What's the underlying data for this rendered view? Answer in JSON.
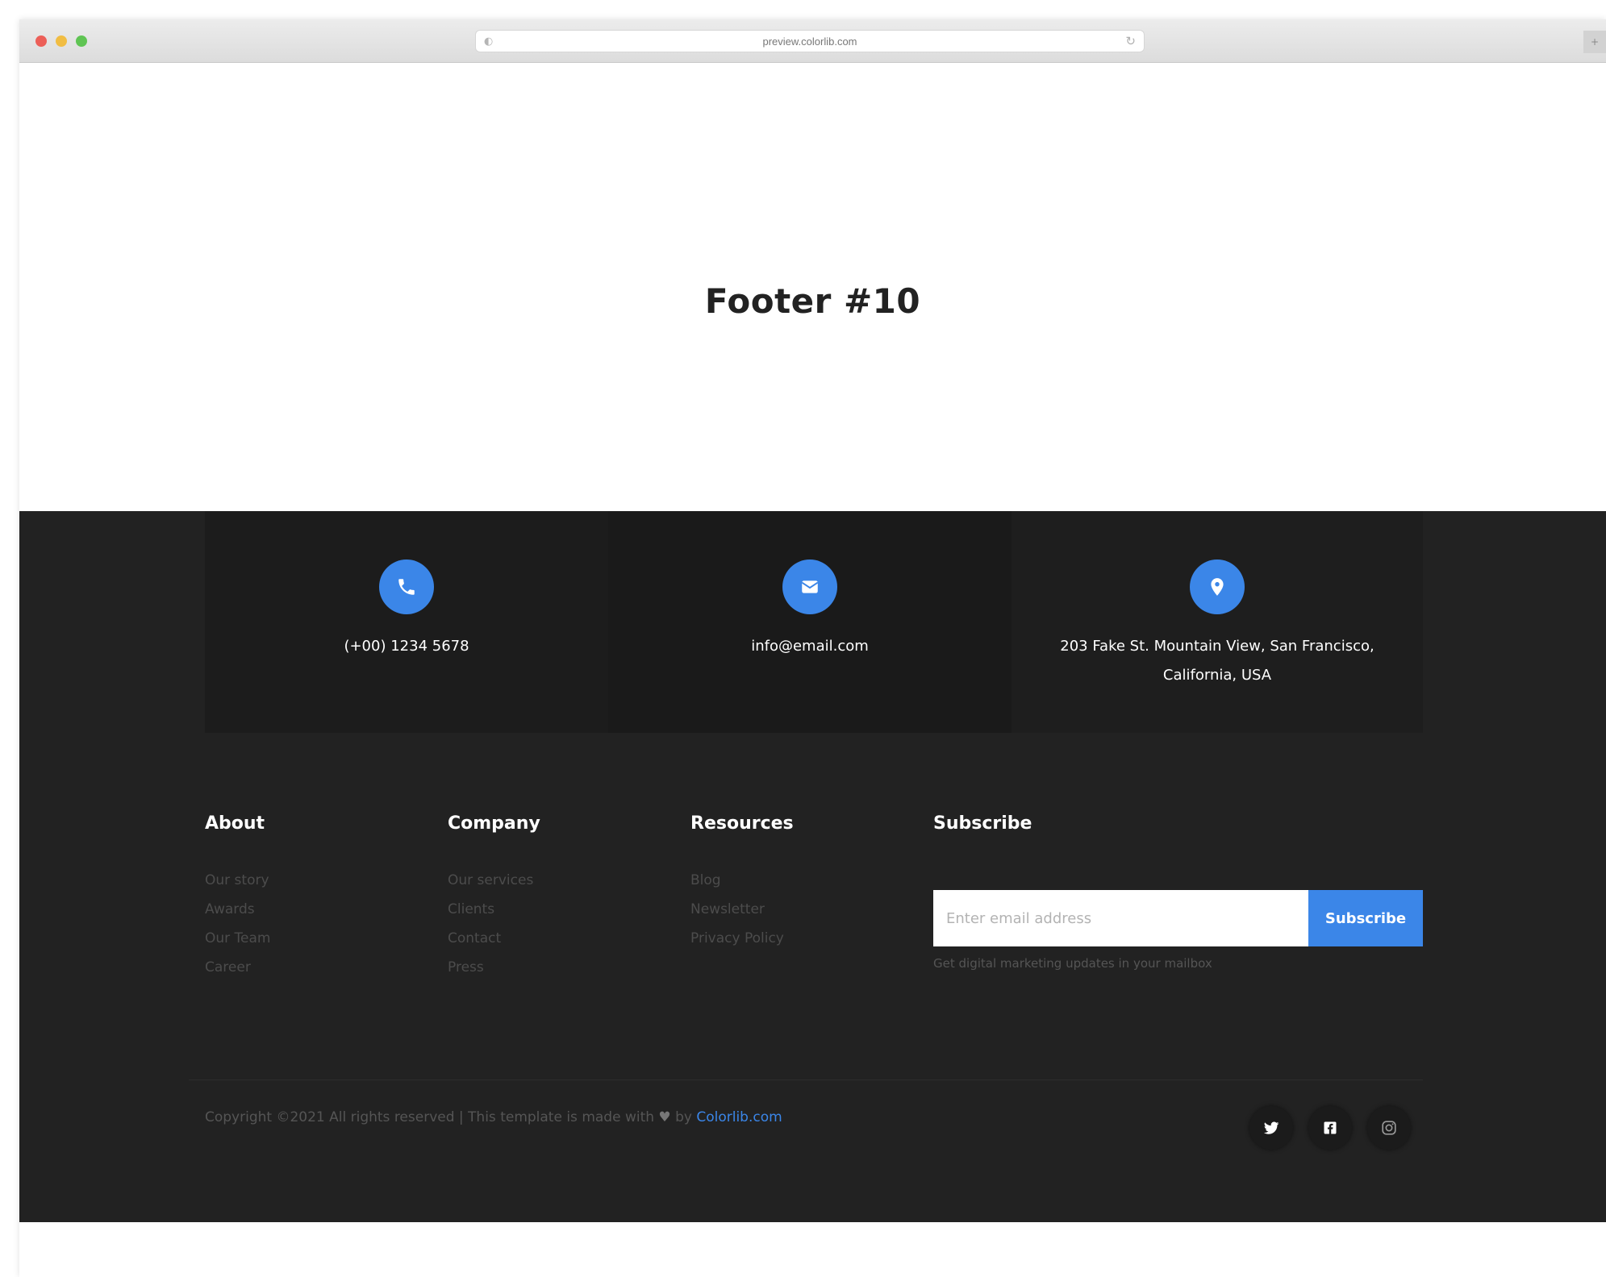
{
  "browser": {
    "url": "preview.colorlib.com"
  },
  "page": {
    "title": "Footer #10"
  },
  "contact": {
    "phone": "(+00) 1234 5678",
    "email": "info@email.com",
    "address_line1": "203 Fake St. Mountain View, San Francisco,",
    "address_line2": "California, USA"
  },
  "columns": {
    "about": {
      "title": "About",
      "links": [
        "Our story",
        "Awards",
        "Our Team",
        "Career"
      ]
    },
    "company": {
      "title": "Company",
      "links": [
        "Our services",
        "Clients",
        "Contact",
        "Press"
      ]
    },
    "resources": {
      "title": "Resources",
      "links": [
        "Blog",
        "Newsletter",
        "Privacy Policy"
      ]
    },
    "subscribe": {
      "title": "Subscribe",
      "placeholder": "Enter email address",
      "button": "Subscribe",
      "note": "Get digital marketing updates in your mailbox"
    }
  },
  "bottom": {
    "copyright_prefix": "Copyright ©2021 All rights reserved | This template is made with",
    "heart": "♥",
    "by": "by",
    "link": "Colorlib.com"
  },
  "social": [
    "twitter-icon",
    "facebook-icon",
    "instagram-icon"
  ],
  "colors": {
    "accent": "#3b86e8",
    "footer_bg": "#222222"
  }
}
